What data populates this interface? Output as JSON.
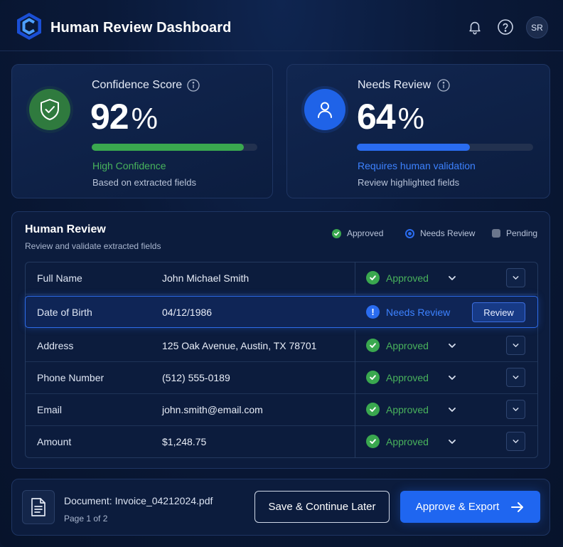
{
  "app": {
    "title": "Human Review Dashboard",
    "avatar_initials": "SR"
  },
  "colors": {
    "accent": "#1f66f0",
    "success": "#3aa84f",
    "background": "#0a1938"
  },
  "icons": [
    "logo-icon",
    "bell-icon",
    "help-icon",
    "shield-check-icon",
    "user-icon",
    "info-icon",
    "check-icon",
    "alert-icon",
    "chevron-down-icon",
    "document-icon",
    "arrow-right-icon"
  ],
  "metrics": [
    {
      "label": "Confidence Score",
      "value": "92",
      "unit": "%",
      "progress": 0.92,
      "status": "High Confidence",
      "sub": "Based on extracted fields"
    },
    {
      "label": "Needs Review",
      "value": "64",
      "unit": "%",
      "progress": 0.64,
      "status": "Requires human validation",
      "sub": "Review highlighted fields"
    }
  ],
  "review": {
    "title": "Human Review",
    "subtitle": "Review and validate extracted fields",
    "legend": {
      "approved": "Approved",
      "needs_review": "Needs Review",
      "pending": "Pending"
    },
    "rows": [
      {
        "field": "Full Name",
        "value": "John Michael Smith",
        "status": "Approved"
      },
      {
        "field": "Date of Birth",
        "value": "04/12/1986",
        "status": "Needs Review",
        "action": "Review"
      },
      {
        "field": "Address",
        "value": "125 Oak Avenue, Austin, TX 78701",
        "status": "Approved"
      },
      {
        "field": "Phone Number",
        "value": "(512) 555-0189",
        "status": "Approved"
      },
      {
        "field": "Email",
        "value": "john.smith@email.com",
        "status": "Approved"
      },
      {
        "field": "Amount",
        "value": "$1,248.75",
        "status": "Approved"
      }
    ]
  },
  "footer": {
    "document": "Document: Invoice_04212024.pdf",
    "page": "Page 1 of 2",
    "save_label": "Save & Continue Later",
    "approve_label": "Approve & Export"
  }
}
